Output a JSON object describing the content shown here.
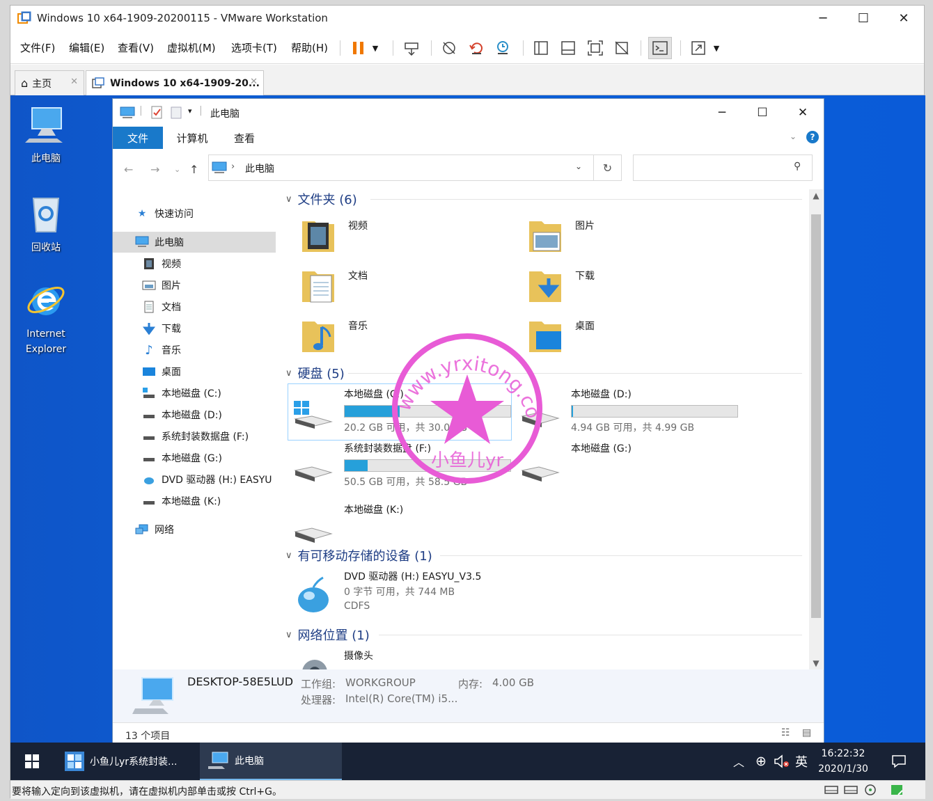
{
  "vm": {
    "title": "Windows 10 x64-1909-20200115 - VMware Workstation",
    "menus": [
      "文件(F)",
      "编辑(E)",
      "查看(V)",
      "虚拟机(M)",
      "选项卡(T)",
      "帮助(H)"
    ],
    "tabs": [
      {
        "label": "主页",
        "icon": "home-icon"
      },
      {
        "label": "Windows 10 x64-1909-20...",
        "icon": "vm-icon"
      }
    ],
    "status_text": "要将输入定向到该虚拟机，请在虚拟机内部单击或按 Ctrl+G。"
  },
  "desktop": {
    "icons": [
      {
        "label": "此电脑",
        "icon": "computer-icon"
      },
      {
        "label": "回收站",
        "icon": "recycle-bin-icon"
      },
      {
        "label": "Internet Explorer",
        "icon": "internet-explorer-icon"
      }
    ]
  },
  "explorer": {
    "title": "此电脑",
    "ribbon_tabs": [
      "文件",
      "计算机",
      "查看"
    ],
    "address": "此电脑",
    "search_placeholder": "",
    "nav": {
      "quick_access": "快速访问",
      "this_pc": "此电脑",
      "items": [
        "视频",
        "图片",
        "文档",
        "下载",
        "音乐",
        "桌面",
        "本地磁盘 (C:)",
        "本地磁盘 (D:)",
        "系统封装数据盘 (F:)",
        "本地磁盘 (G:)",
        "DVD 驱动器 (H:) EASYU",
        "本地磁盘 (K:)"
      ],
      "network": "网络"
    },
    "groups": {
      "folders": "文件夹 (6)",
      "drives": "硬盘 (5)",
      "removable": "有可移动存储的设备 (1)",
      "network": "网络位置 (1)"
    },
    "folders": [
      "视频",
      "图片",
      "文档",
      "下载",
      "音乐",
      "桌面"
    ],
    "drives": [
      {
        "name": "本地磁盘 (C:)",
        "free": "20.2 GB 可用，共 30.0 GB",
        "used_fraction": 0.33
      },
      {
        "name": "本地磁盘 (D:)",
        "free": "4.94 GB 可用，共 4.99 GB",
        "used_fraction": 0.01
      },
      {
        "name": "系统封装数据盘 (F:)",
        "free": "50.5 GB 可用，共 58.5 GB",
        "used_fraction": 0.14
      },
      {
        "name": "本地磁盘 (G:)"
      },
      {
        "name": "本地磁盘 (K:)"
      }
    ],
    "dvd": {
      "name": "DVD 驱动器 (H:) EASYU_V3.5",
      "free": "0 字节 可用，共 744 MB",
      "fs": "CDFS"
    },
    "network_item": "摄像头",
    "details": {
      "computer_name": "DESKTOP-58E5LUD",
      "workgroup_label": "工作组:",
      "workgroup": "WORKGROUP",
      "memory_label": "内存:",
      "memory": "4.00 GB",
      "cpu_label": "处理器:",
      "cpu": "Intel(R) Core(TM) i5..."
    },
    "status": "13 个项目"
  },
  "taskbar": {
    "apps": [
      "小鱼儿yr系统封装...",
      "此电脑"
    ],
    "ime": "英",
    "time": "16:22:32",
    "date": "2020/1/30"
  },
  "watermark": {
    "text_top": "www.yrxitong.com",
    "text_bottom": "小鱼儿yr",
    "color": "#e85bd6"
  }
}
